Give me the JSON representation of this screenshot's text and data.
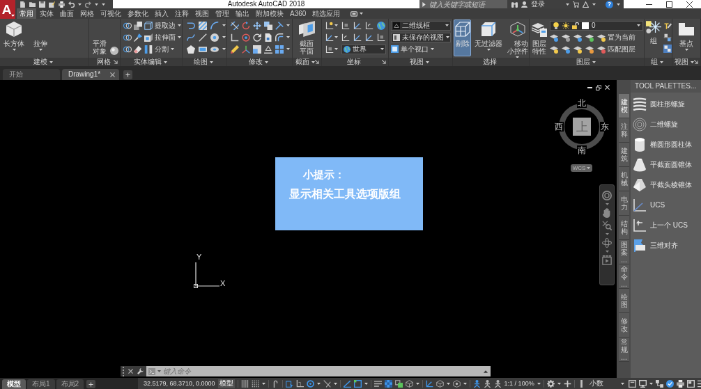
{
  "app_button": {
    "label": "A"
  },
  "window": {
    "title": "Autodesk AutoCAD 2018"
  },
  "search": {
    "placeholder": "键入关键字或短语"
  },
  "account": {
    "sign_in": "登录"
  },
  "help_button": {
    "label": "?"
  },
  "ribbon_tabs": [
    {
      "label": "常用",
      "selected": true
    },
    {
      "label": "实体",
      "selected": false
    },
    {
      "label": "曲面",
      "selected": false
    },
    {
      "label": "网格",
      "selected": false
    },
    {
      "label": "可视化",
      "selected": false
    },
    {
      "label": "参数化",
      "selected": false
    },
    {
      "label": "插入",
      "selected": false
    },
    {
      "label": "注释",
      "selected": false
    },
    {
      "label": "视图",
      "selected": false
    },
    {
      "label": "管理",
      "selected": false
    },
    {
      "label": "输出",
      "selected": false
    },
    {
      "label": "附加模块",
      "selected": false
    },
    {
      "label": "A360",
      "selected": false
    },
    {
      "label": "精选应用",
      "selected": false
    }
  ],
  "ribbon_panels": [
    {
      "title": "建模",
      "buttons": [
        {
          "label": "长方体"
        },
        {
          "label": "拉伸"
        }
      ]
    },
    {
      "title": "网格",
      "buttons": [
        {
          "label": "平滑对象"
        }
      ]
    },
    {
      "title": "实体编辑",
      "buttons": [
        {
          "label": "提取边"
        },
        {
          "label": "拉伸面"
        },
        {
          "label": "分割"
        }
      ]
    },
    {
      "title": "绘图"
    },
    {
      "title": "修改"
    },
    {
      "title": "截面",
      "buttons": [
        {
          "label": "截面平面"
        }
      ]
    },
    {
      "title": "坐标",
      "dropdowns": [
        {
          "value": "世界"
        }
      ]
    },
    {
      "title": "视图",
      "dropdowns": [
        {
          "value": "二维线框"
        },
        {
          "value": "未保存的视图"
        }
      ],
      "buttons": [
        {
          "label": "单个视口"
        }
      ]
    },
    {
      "title": "选择",
      "buttons": [
        {
          "label": "剔除",
          "on": true
        },
        {
          "label": "无过滤器",
          "on": false
        },
        {
          "label": "移动小控件",
          "on": false
        }
      ]
    },
    {
      "title": "图层",
      "dropdowns": [
        {
          "value": "0"
        }
      ],
      "buttons": [
        {
          "label": "图层特性"
        },
        {
          "label": "置为当前"
        },
        {
          "label": "匹配图层"
        }
      ]
    },
    {
      "title": "组",
      "buttons": [
        {
          "label": "组"
        }
      ],
      "tools": [
        {
          "on": false
        },
        {
          "on": false
        },
        {
          "on": true
        }
      ]
    },
    {
      "title": "视图",
      "buttons": [
        {
          "label": "基点"
        }
      ]
    }
  ],
  "file_tabs": [
    {
      "label": "开始",
      "selected": false
    },
    {
      "label": "Drawing1*",
      "selected": true
    }
  ],
  "tip": {
    "title": "小提示：",
    "text": "显示相关工具选项版组"
  },
  "view_cube": {
    "face": "上",
    "north": "北",
    "south": "南",
    "west": "西",
    "east": "东",
    "ucs_menu": "WCS"
  },
  "ucs_icon": {
    "x_label": "X",
    "y_label": "Y"
  },
  "command_line": {
    "placeholder": "键入命令"
  },
  "tool_palettes": {
    "title": "TOOL PALETTES...",
    "tabs": [
      {
        "label": "建模",
        "selected": true
      },
      {
        "label": "注释",
        "selected": false
      },
      {
        "label": "建筑",
        "selected": false
      },
      {
        "label": "机械",
        "selected": false
      },
      {
        "label": "电力",
        "selected": false
      },
      {
        "label": "结构",
        "selected": false
      },
      {
        "label": "图案...",
        "selected": false
      },
      {
        "label": "命令...",
        "selected": false
      },
      {
        "label": "绘图",
        "selected": false
      },
      {
        "label": "修改",
        "selected": false
      },
      {
        "label": "常规...",
        "selected": false
      }
    ],
    "items": [
      {
        "label": "圆柱形螺旋"
      },
      {
        "label": "二维螺旋"
      },
      {
        "label": "椭圆形圆柱体"
      },
      {
        "label": "平截面圆锥体"
      },
      {
        "label": "平截头棱锥体"
      },
      {
        "label": "UCS"
      },
      {
        "label": "上一个 UCS"
      },
      {
        "label": "三维对齐"
      }
    ]
  },
  "layout_tabs": [
    {
      "label": "模型",
      "selected": true
    },
    {
      "label": "布局1",
      "selected": false
    },
    {
      "label": "布局2",
      "selected": false
    }
  ],
  "status_bar": {
    "coordinates": "32.5179, 68.3710, 0.0000",
    "space": "模型",
    "toggles": [
      {
        "on": false
      },
      {
        "on": false
      },
      {
        "on": false
      },
      {
        "on": true
      },
      {
        "on": false
      },
      {
        "on": true
      },
      {
        "on": false
      },
      {
        "on": true
      },
      {
        "on": true
      },
      {
        "on": false
      },
      {
        "on": true
      },
      {
        "on": false
      },
      {
        "on": false
      },
      {
        "on": true
      },
      {
        "on": false
      },
      {
        "on": false
      },
      {
        "on": true
      },
      {
        "on": false
      },
      {
        "on": false
      },
      {
        "on": true
      }
    ],
    "scale": "1:1 / 100%",
    "units": "小数"
  }
}
